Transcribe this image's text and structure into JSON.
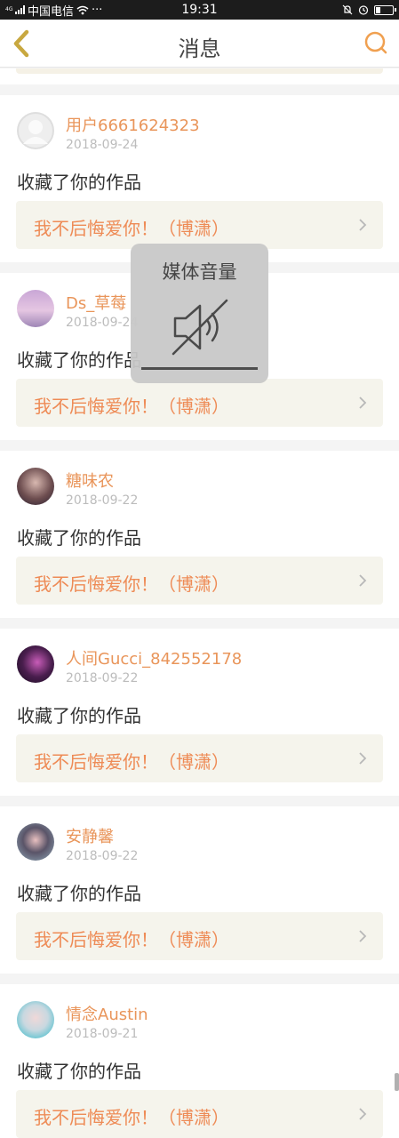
{
  "status_bar": {
    "carrier": "中国电信",
    "network": "4G",
    "dots": "···",
    "time": "19:31"
  },
  "header": {
    "title": "消息"
  },
  "notifications": [
    {
      "username": "用户6661624323",
      "date": "2018-09-24",
      "action": "收藏了你的作品",
      "work_title": "我不后悔爱你！（博潇）",
      "avatar": "default"
    },
    {
      "username": "Ds_草莓",
      "date": "2018-09-24",
      "action": "收藏了你的作品",
      "work_title": "我不后悔爱你！（博潇）",
      "avatar": "pastel-purple"
    },
    {
      "username": "糖味农",
      "date": "2018-09-22",
      "action": "收藏了你的作品",
      "work_title": "我不后悔爱你！（博潇）",
      "avatar": "photo-person"
    },
    {
      "username": "人间Gucci_842552178",
      "date": "2018-09-22",
      "action": "收藏了你的作品",
      "work_title": "我不后悔爱你！（博潇）",
      "avatar": "dark-purple"
    },
    {
      "username": "安静馨",
      "date": "2018-09-22",
      "action": "收藏了你的作品",
      "work_title": "我不后悔爱你！（博潇）",
      "avatar": "photo-girl"
    },
    {
      "username": "情念Austin",
      "date": "2018-09-21",
      "action": "收藏了你的作品",
      "work_title": "我不后悔爱你！（博潇）",
      "avatar": "photo-teal"
    }
  ],
  "volume_overlay": {
    "title": "媒体音量",
    "icon": "speaker-muted-icon",
    "level": 0
  },
  "colors": {
    "accent": "#e9955a",
    "work_text": "#ee8b56",
    "back_icon": "#c8a840",
    "search_icon": "#f0a050"
  }
}
